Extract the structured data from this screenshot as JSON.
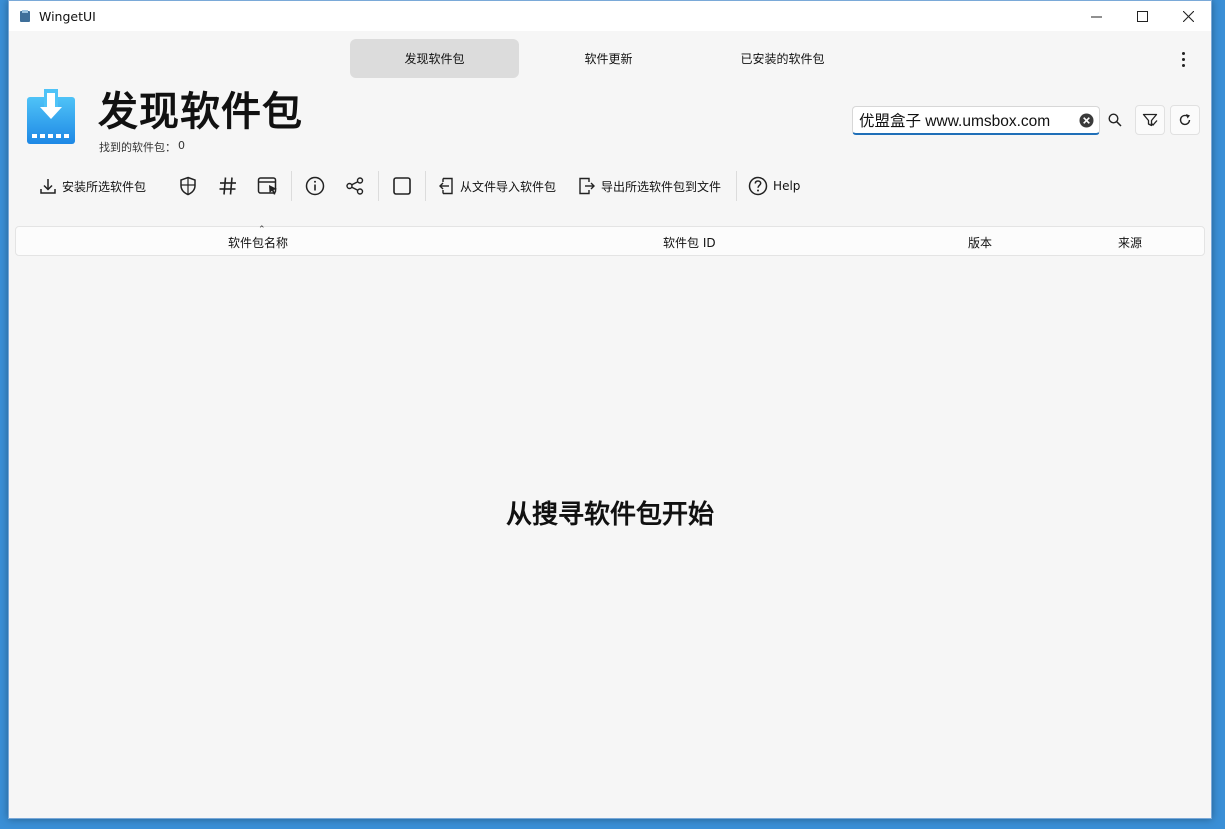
{
  "window": {
    "title": "WingetUI"
  },
  "tabs": [
    {
      "label": "发现软件包",
      "active": true
    },
    {
      "label": "软件更新",
      "active": false
    },
    {
      "label": "已安装的软件包",
      "active": false
    }
  ],
  "header": {
    "title": "发现软件包",
    "found_label": "找到的软件包：",
    "found_count": "0"
  },
  "search": {
    "value": "优盟盒子 www.umsbox.com"
  },
  "toolbar": {
    "install_label": "安装所选软件包",
    "import_label": "从文件导入软件包",
    "export_label": "导出所选软件包到文件",
    "help_label": "Help"
  },
  "table": {
    "columns": [
      "软件包名称",
      "软件包 ID",
      "版本",
      "来源"
    ],
    "rows": []
  },
  "empty_message": "从搜寻软件包开始",
  "colors": {
    "accent": "#1f6fb8",
    "icon_blue": "#1e88e5",
    "icon_light": "#4fc3f7"
  }
}
